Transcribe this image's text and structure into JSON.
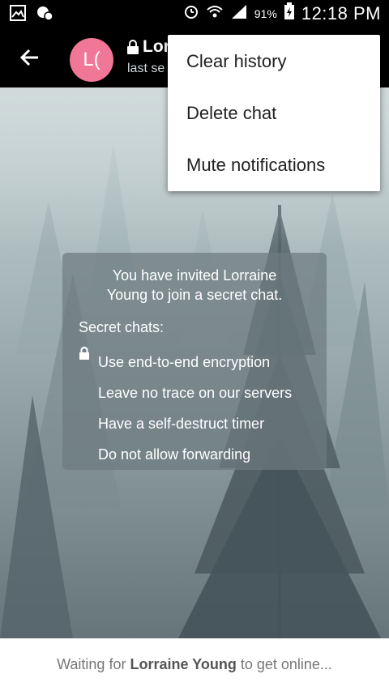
{
  "status_bar": {
    "battery_percent": "91%",
    "time": "12:18 PM",
    "icons": [
      "gallery-icon",
      "notification-icon",
      "alarm-icon",
      "wifi-icon",
      "signal-icon",
      "battery-charging-icon"
    ]
  },
  "header": {
    "avatar_text": "L(",
    "title": "Lor",
    "subtitle": "last se",
    "avatar_color": "#f07796"
  },
  "menu": {
    "items": [
      "Clear history",
      "Delete chat",
      "Mute notifications"
    ]
  },
  "info_card": {
    "message": "You have invited Lorraine Young to join a secret chat.",
    "label": "Secret chats:",
    "features": [
      "Use end-to-end encryption",
      "Leave no trace on our servers",
      "Have a self-destruct timer",
      "Do not allow forwarding"
    ]
  },
  "footer": {
    "prefix": "Waiting for ",
    "name": "Lorraine Young",
    "suffix": " to get online..."
  }
}
